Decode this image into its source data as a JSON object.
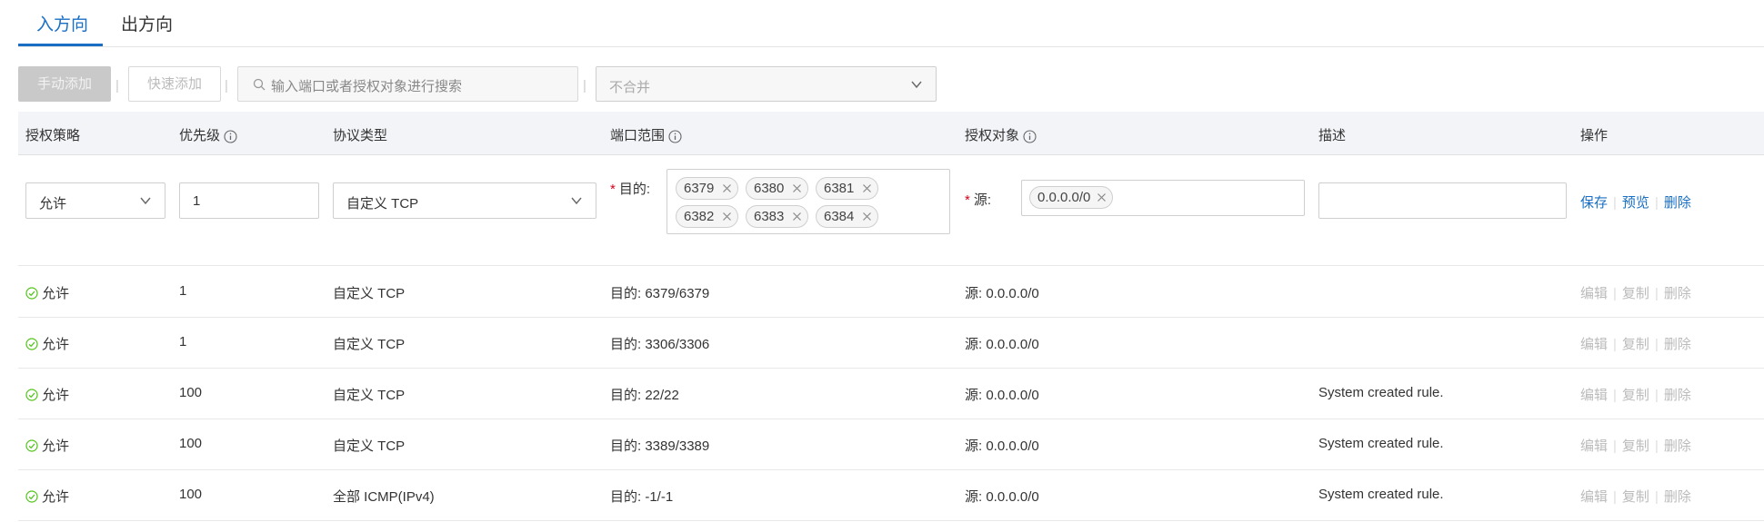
{
  "tabs": [
    {
      "label": "入方向",
      "active": true
    },
    {
      "label": "出方向",
      "active": false
    }
  ],
  "toolbar": {
    "manual_add": "手动添加",
    "quick_add": "快速添加",
    "separator": "|",
    "search_placeholder": "输入端口或者授权对象进行搜索",
    "merge_select": "不合并"
  },
  "columns": [
    "授权策略",
    "优先级",
    "协议类型",
    "端口范围",
    "授权对象",
    "描述",
    "操作"
  ],
  "edit_row": {
    "policy": "允许",
    "priority": "1",
    "protocol": "自定义 TCP",
    "port_label": "目的:",
    "ports": [
      "6379",
      "6380",
      "6381",
      "6382",
      "6383",
      "6384"
    ],
    "source_label": "源:",
    "sources": [
      "0.0.0.0/0"
    ],
    "description": "",
    "actions": [
      "保存",
      "预览",
      "删除"
    ]
  },
  "rows": [
    {
      "policy": "允许",
      "priority": "1",
      "protocol": "自定义 TCP",
      "port": "目的: 6379/6379",
      "source": "源: 0.0.0.0/0",
      "description": ""
    },
    {
      "policy": "允许",
      "priority": "1",
      "protocol": "自定义 TCP",
      "port": "目的: 3306/3306",
      "source": "源: 0.0.0.0/0",
      "description": ""
    },
    {
      "policy": "允许",
      "priority": "100",
      "protocol": "自定义 TCP",
      "port": "目的: 22/22",
      "source": "源: 0.0.0.0/0",
      "description": "System created rule."
    },
    {
      "policy": "允许",
      "priority": "100",
      "protocol": "自定义 TCP",
      "port": "目的: 3389/3389",
      "source": "源: 0.0.0.0/0",
      "description": "System created rule."
    },
    {
      "policy": "允许",
      "priority": "100",
      "protocol": "全部 ICMP(IPv4)",
      "port": "目的: -1/-1",
      "source": "源: 0.0.0.0/0",
      "description": "System created rule."
    }
  ],
  "row_actions": [
    "编辑",
    "复制",
    "删除"
  ],
  "colors": {
    "accent": "#1a6fc4",
    "allow": "#52c41a",
    "required": "#d9001b"
  }
}
